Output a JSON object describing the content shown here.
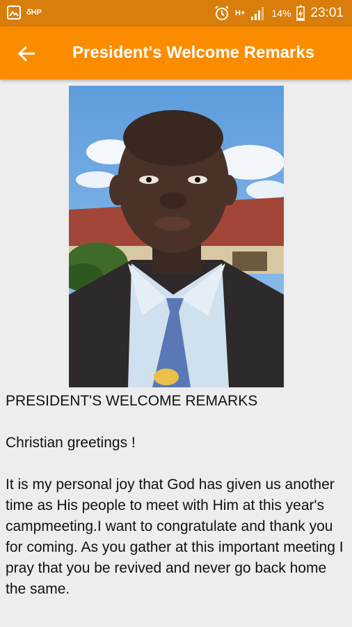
{
  "status_bar": {
    "left_label": "δ̇HP",
    "network": "H+",
    "battery_percent": "14%",
    "time": "23:01"
  },
  "app_bar": {
    "title": "President's Welcome Remarks"
  },
  "article": {
    "heading": "PRESIDENT'S WELCOME REMARKS",
    "greeting": "Christian greetings !",
    "body": "It is my personal joy that God has given us another time as His people to meet with Him at this year's campmeeting.I want to congratulate and thank you for coming. As you gather at this important meeting I pray that you be revived and never go back home the same."
  },
  "colors": {
    "status_bar": "#d97e0a",
    "app_bar": "#fb8c00",
    "background": "#ededed"
  }
}
